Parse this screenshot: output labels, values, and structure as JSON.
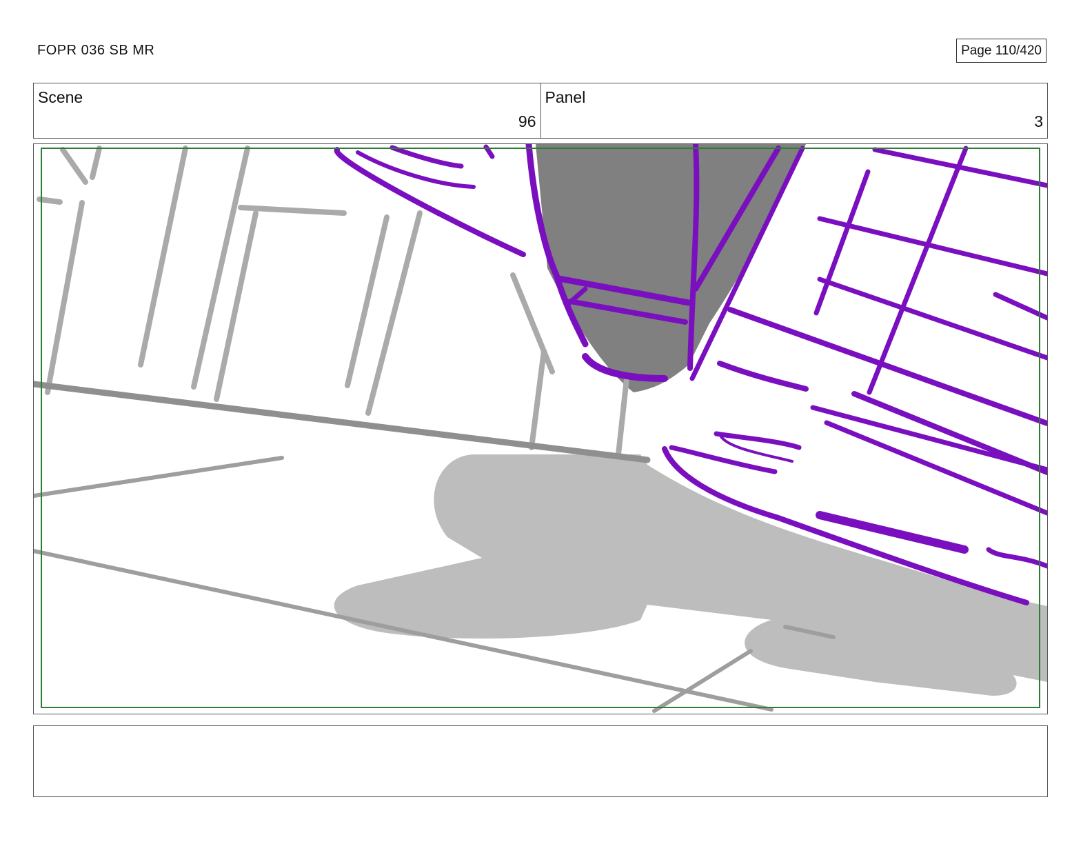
{
  "document": {
    "title": "FOPR 036 SB MR",
    "page_label": "Page 110/420"
  },
  "header": {
    "scene_label": "Scene",
    "scene_value": "96",
    "panel_label": "Panel",
    "panel_value": "3"
  },
  "panel": {
    "safe_frame_color": "#2e7d32",
    "ink_color": "#7a0fbf",
    "tone_dark": "#808080",
    "tone_light": "#bdbdbd",
    "line_gray": "#9e9e9e"
  },
  "notes": {
    "text": ""
  }
}
